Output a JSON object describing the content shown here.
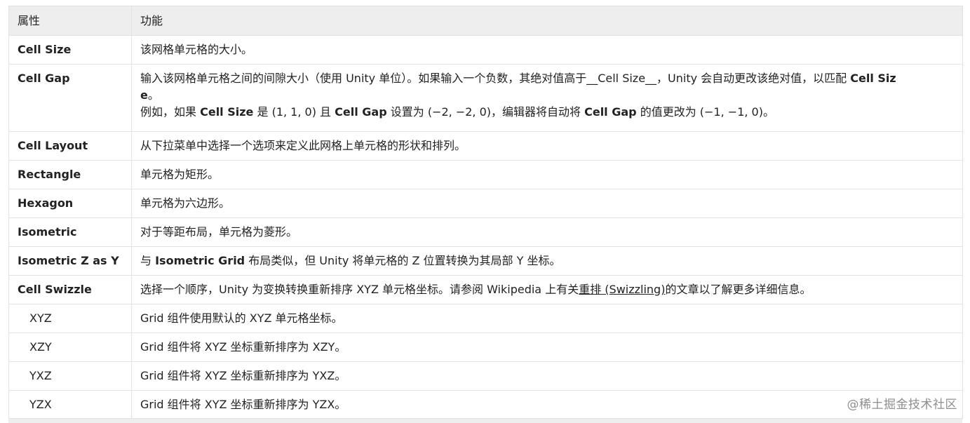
{
  "table": {
    "headers": {
      "property": "属性",
      "function": "功能"
    },
    "rows": [
      {
        "name": "Cell Size",
        "desc": "该网格单元格的大小。"
      },
      {
        "name": "Cell Gap",
        "line1_a": "输入该网格单元格之间的间隙大小（使用 Unity 单位）。如果输入一个负数，其绝对值高于__Cell Size__，Unity 会自动更改该绝对值，以匹配 ",
        "line1_b": "Cell Siz",
        "line2_b": "e",
        "line2_a": "。",
        "line3": [
          "例如，如果 ",
          "Cell Size",
          " 是 (1, 1, 0) 且 ",
          "Cell Gap",
          " 设置为 (−2, −2, 0)，编辑器将自动将 ",
          "Cell Gap",
          " 的值更改为 (−1, −1, 0)。"
        ]
      },
      {
        "name": "Cell Layout",
        "desc": "从下拉菜单中选择一个选项来定义此网格上单元格的形状和排列。"
      },
      {
        "name": "Rectangle",
        "desc": "单元格为矩形。"
      },
      {
        "name": "Hexagon",
        "desc": "单元格为六边形。"
      },
      {
        "name": "Isometric",
        "desc": "对于等距布局，单元格为菱形。"
      },
      {
        "name": "Isometric Z as Y",
        "desc_parts": [
          "与 ",
          "Isometric Grid",
          " 布局类似，但 Unity 将单元格的 Z 位置转换为其局部 Y 坐标。"
        ]
      },
      {
        "name": "Cell Swizzle",
        "desc_parts": [
          "选择一个顺序，Unity 为变换转换重新排序 XYZ 单元格坐标。请参阅 Wikipedia 上有关",
          "重排 (Swizzling)",
          "的文章以了解更多详细信息。"
        ]
      },
      {
        "name": "XYZ",
        "desc": "Grid 组件使用默认的 XYZ 单元格坐标。"
      },
      {
        "name": "XZY",
        "desc": "Grid 组件将 XYZ 坐标重新排序为 XZY。"
      },
      {
        "name": "YXZ",
        "desc": "Grid 组件将 XYZ 坐标重新排序为 YXZ。"
      },
      {
        "name": "YZX",
        "desc": "Grid 组件将 XYZ 坐标重新排序为 YZX。"
      }
    ]
  },
  "watermark": "@稀土掘金技术社区"
}
